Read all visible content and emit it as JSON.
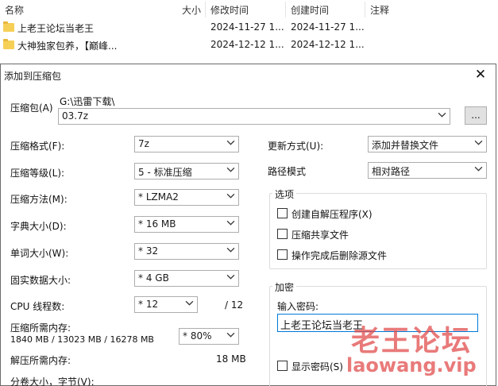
{
  "explorer": {
    "columns": {
      "name": "名称",
      "size": "大小",
      "modified": "修改时间",
      "created": "创建时间",
      "comment": "注释"
    },
    "rows": [
      {
        "name": "上老王论坛当老王",
        "modified": "2024-11-27 1...",
        "created": "2024-11-27 1..."
      },
      {
        "name": "大神独家包养，【巅峰...",
        "modified": "2024-12-12 1...",
        "created": "2024-12-12 1..."
      }
    ]
  },
  "dialog": {
    "title": "添加到压缩包",
    "close_glyph": "✕",
    "archive_label": "压缩包(A)",
    "archive_path": "G:\\迅雷下载\\",
    "archive_name": "03.7z",
    "browse_label": "...",
    "format_label": "压缩格式(F):",
    "format_value": "7z",
    "level_label": "压缩等级(L):",
    "level_value": "5 - 标准压缩",
    "method_label": "压缩方法(M):",
    "method_value": "*  LZMA2",
    "dict_label": "字典大小(D):",
    "dict_value": "*  16 MB",
    "word_label": "单词大小(W):",
    "word_value": "*  32",
    "solid_label": "固实数据大小:",
    "solid_value": "*  4 GB",
    "threads_label": "CPU 线程数:",
    "threads_value": "*  12",
    "threads_total": "/ 12",
    "mem_comp_label": "压缩所需内存:",
    "mem_comp_detail": "1840 MB / 13023 MB / 16278 MB",
    "mem_percent": "*  80%",
    "mem_decomp_label": "解压所需内存:",
    "mem_decomp_value": "18 MB",
    "split_label": "分卷大小，字节(V):",
    "update_label": "更新方式(U):",
    "update_value": "添加并替换文件",
    "path_label": "路径模式",
    "path_value": "相对路径",
    "options_title": "选项",
    "opt_sfx": "创建自解压程序(X)",
    "opt_shared": "压缩共享文件",
    "opt_delete": "操作完成后删除源文件",
    "encrypt_title": "加密",
    "pwd_label": "输入密码:",
    "pwd_value": "上老王论坛当老王",
    "show_pwd_partial": "显示密码(S)"
  },
  "watermark": {
    "line1": "老王论坛",
    "line2": "laowang.vip"
  }
}
